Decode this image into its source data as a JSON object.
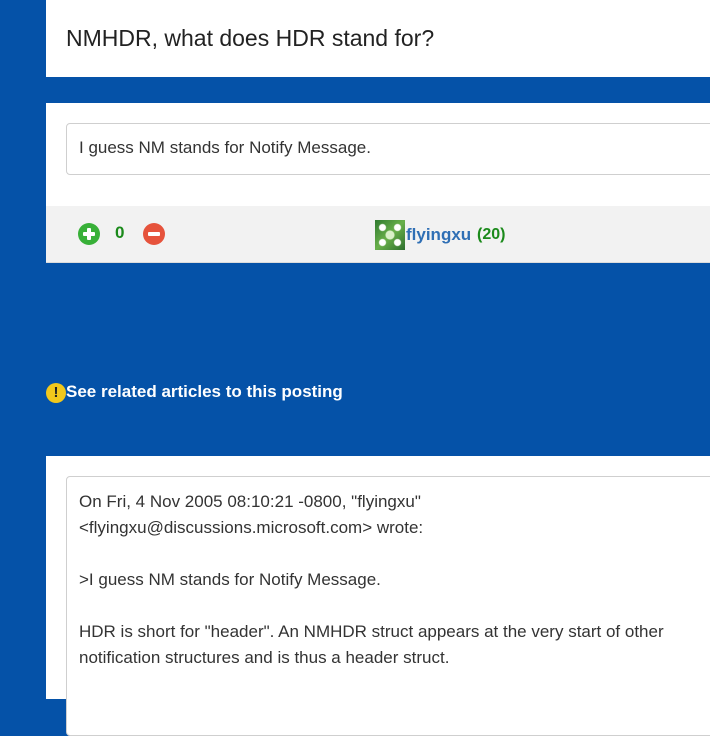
{
  "question": {
    "title": "NMHDR, what does HDR stand for?"
  },
  "answer": {
    "text": "I guess NM stands for Notify Message.",
    "votes": "0",
    "author": {
      "name": "flyingxu",
      "reputation": "(20)"
    }
  },
  "related": {
    "label": "See related articles to this posting",
    "icon": "!"
  },
  "reply": {
    "header_line1": "On Fri, 4 Nov 2005 08:10:21 -0800, \"flyingxu\"",
    "header_line2": "<flyingxu@discussions.microsoft.com> wrote:",
    "quote": ">I guess NM stands for Notify Message.",
    "body": "HDR is short for \"header\". An NMHDR struct appears at the very start of other notification structures and is thus a header struct."
  },
  "colors": {
    "background": "#0552a8",
    "upvote": "#38b038",
    "downvote": "#e6533c",
    "author": "#2f6fb5",
    "reputation": "#1b8a1b",
    "warning": "#f2c81c"
  }
}
